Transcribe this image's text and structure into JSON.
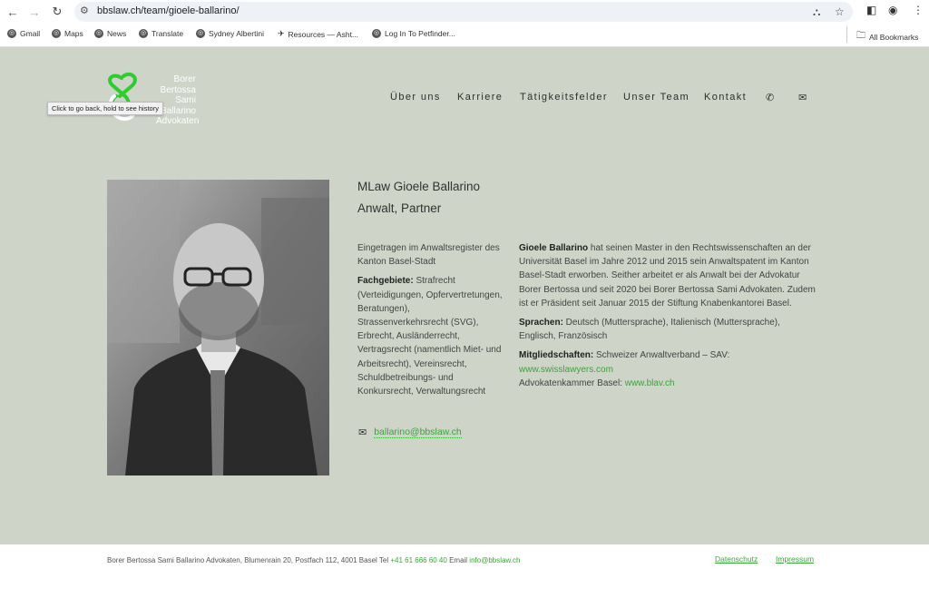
{
  "browser": {
    "url": "bbslaw.ch/team/gioele-ballarino/",
    "bookmarks": [
      "Gmail",
      "Maps",
      "News",
      "Translate",
      "Sydney Albertini",
      "Resources — Asht...",
      "Log In To Petfinder..."
    ],
    "all_bookmarks": "All Bookmarks"
  },
  "tooltip": "Click to go back, hold to see history",
  "logo": {
    "words": [
      "Borer",
      "Bertossa",
      "Sami",
      "Ballarino",
      "Advokaten"
    ]
  },
  "nav": {
    "items": [
      "Über uns",
      "Karriere",
      "Tätigkeitsfelder",
      "Unser Team",
      "Kontakt"
    ]
  },
  "profile": {
    "name": "MLaw Gioele Ballarino",
    "role": "Anwalt, Partner",
    "registry": "Eingetragen im Anwaltsregister des Kanton Basel-Stadt",
    "fields_label": "Fachgebiete:",
    "fields_text": " Strafrecht (Verteidigungen, Opfervertretungen, Beratungen), Strassenverkehrsrecht (SVG), Erbrecht, Ausländerrecht, Vertragsrecht (namentlich Miet- und Arbeitsrecht), Vereinsrecht, Schuldbetreibungs- und Konkursrecht, Verwaltungsrecht",
    "bio_name": "Gioele Ballarino",
    "bio_text": " hat seinen Master in den Rechtswissenschaften an der Universität Basel im Jahre 2012 und 2015 sein Anwaltspatent im Kanton Basel-Stadt erworben. Seither arbeitet er als Anwalt bei der Advokatur Borer Bertossa und seit 2020 bei Borer Bertossa Sami Advokaten. Zudem ist er Präsident seit Januar 2015 der Stiftung Knabenkantorei Basel.",
    "lang_label": "Sprachen:",
    "lang_text": " Deutsch (Muttersprache), Italienisch (Muttersprache), Englisch, Französisch",
    "member_label": "Mitgliedschaften:",
    "member_text1": " Schweizer Anwaltverband – SAV:",
    "member_link1": "www.swisslawyers.com",
    "member_text2": "Advokatenkammer Basel: ",
    "member_link2": "www.blav.ch",
    "email": "ballarino@bbslaw.ch"
  },
  "footer": {
    "address": "Borer Bertossa Sami Ballarino Advokaten,  Blumenrain 20, Postfach 112, 4001 Basel  Tel ",
    "phone": "+41 61 666 60 40",
    "email_label": " Email ",
    "email": "info@bbslaw.ch",
    "links": [
      "Datenschutz",
      "Impressum"
    ]
  },
  "colors": {
    "accent": "#3aa53a",
    "background": "#ced4c8",
    "logo_green": "#2ecc2e"
  }
}
